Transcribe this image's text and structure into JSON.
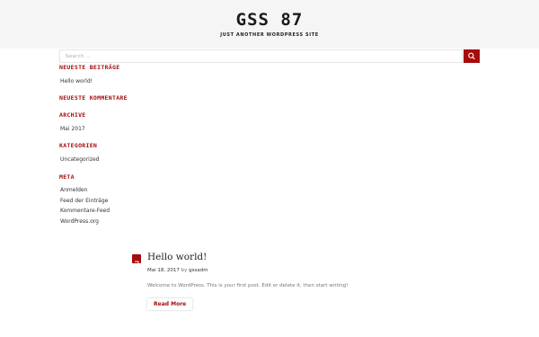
{
  "header": {
    "site_title": "GSS 87",
    "site_description": "JUST ANOTHER WORDPRESS SITE"
  },
  "search": {
    "placeholder": "Search ...",
    "button_icon": "search-icon"
  },
  "sidebar": {
    "recent_posts_title": "NEUESTE BEITRÄGE",
    "recent_posts": [
      "Hello world!"
    ],
    "recent_comments_title": "NEUESTE KOMMENTARE",
    "archives_title": "ARCHIVE",
    "archives": [
      "Mai 2017"
    ],
    "categories_title": "KATEGORIEN",
    "categories": [
      "Uncategorized"
    ],
    "meta_title": "META",
    "meta": [
      "Anmelden",
      "Feed der Einträge",
      "Kommentare-Feed",
      "WordPress.org"
    ]
  },
  "post": {
    "icon": "post-format-icon",
    "title": "Hello world!",
    "date": "Mai 18, 2017",
    "by": "by",
    "author": "gssadm",
    "excerpt": "Welcome to WordPress. This is your first post. Edit or delete it, then start writing!",
    "read_more": "Read More"
  },
  "colors": {
    "accent": "#a60c0c",
    "header_bg": "#f5f5f5"
  }
}
